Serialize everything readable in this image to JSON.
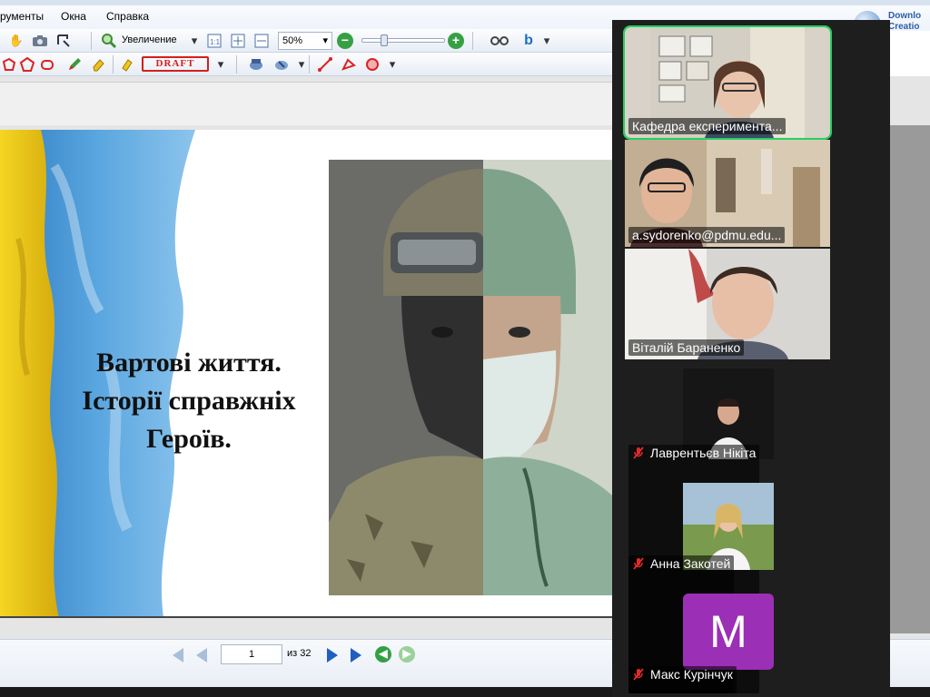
{
  "menubar": {
    "items": [
      "рументы",
      "Окна",
      "Справка"
    ],
    "download_text": [
      "Downlo",
      "Creatio"
    ]
  },
  "toolbar": {
    "zoom_label": "Увеличение",
    "zoom_value": "50%",
    "draft_label": "DRAFT"
  },
  "slide": {
    "title_lines": [
      "Вартові життя.",
      "Історії справжніх",
      "Героїв."
    ]
  },
  "navigation": {
    "page_number": "1",
    "page_total": "из 32"
  },
  "participants": [
    {
      "name": "Кафедра експеримента...",
      "muted": false,
      "active_speaker": true
    },
    {
      "name": "a.sydorenko@pdmu.edu...",
      "muted": false,
      "active_speaker": false
    },
    {
      "name": "Віталій Бараненко",
      "muted": false,
      "active_speaker": false
    },
    {
      "name": "Лаврентьєв Нікіта",
      "muted": true,
      "active_speaker": false
    },
    {
      "name": "Анна Закотей",
      "muted": true,
      "active_speaker": false
    },
    {
      "name": "Макс Курінчук",
      "muted": true,
      "active_speaker": false,
      "avatar_letter": "M",
      "avatar_color": "#9b2fb5"
    }
  ],
  "colors": {
    "active_speaker_border": "#23d160",
    "mute_icon": "#e02b2b",
    "flag_blue": "#3f8fd0",
    "flag_yellow": "#f2cf1f"
  }
}
